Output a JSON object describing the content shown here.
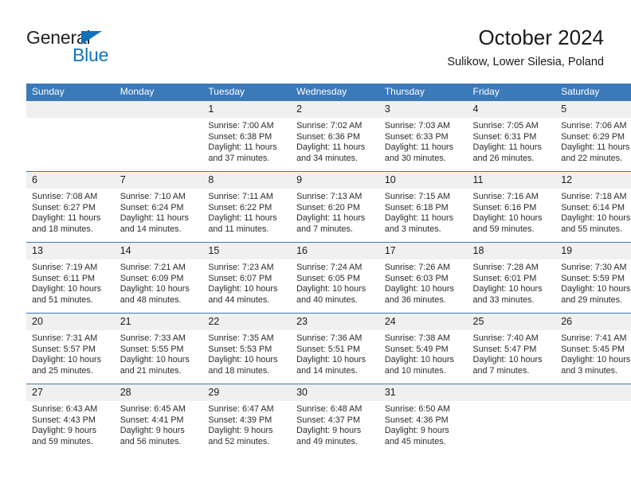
{
  "brand": {
    "name_part1": "General",
    "name_part2": "Blue",
    "logo_icon": "triangle-icon",
    "color_primary": "#1072bb",
    "color_text": "#231f20"
  },
  "header": {
    "title": "October 2024",
    "subtitle": "Sulikow, Lower Silesia, Poland"
  },
  "calendar": {
    "header_color": "#3b79b8",
    "daynum_bg": "#f0f0f0",
    "weekday_headers": [
      "Sunday",
      "Monday",
      "Tuesday",
      "Wednesday",
      "Thursday",
      "Friday",
      "Saturday"
    ],
    "weeks": [
      [
        {
          "day": "",
          "lines": []
        },
        {
          "day": "",
          "lines": []
        },
        {
          "day": "1",
          "lines": [
            "Sunrise: 7:00 AM",
            "Sunset: 6:38 PM",
            "Daylight: 11 hours",
            "and 37 minutes."
          ]
        },
        {
          "day": "2",
          "lines": [
            "Sunrise: 7:02 AM",
            "Sunset: 6:36 PM",
            "Daylight: 11 hours",
            "and 34 minutes."
          ]
        },
        {
          "day": "3",
          "lines": [
            "Sunrise: 7:03 AM",
            "Sunset: 6:33 PM",
            "Daylight: 11 hours",
            "and 30 minutes."
          ]
        },
        {
          "day": "4",
          "lines": [
            "Sunrise: 7:05 AM",
            "Sunset: 6:31 PM",
            "Daylight: 11 hours",
            "and 26 minutes."
          ]
        },
        {
          "day": "5",
          "lines": [
            "Sunrise: 7:06 AM",
            "Sunset: 6:29 PM",
            "Daylight: 11 hours",
            "and 22 minutes."
          ]
        }
      ],
      [
        {
          "day": "6",
          "lines": [
            "Sunrise: 7:08 AM",
            "Sunset: 6:27 PM",
            "Daylight: 11 hours",
            "and 18 minutes."
          ]
        },
        {
          "day": "7",
          "lines": [
            "Sunrise: 7:10 AM",
            "Sunset: 6:24 PM",
            "Daylight: 11 hours",
            "and 14 minutes."
          ]
        },
        {
          "day": "8",
          "lines": [
            "Sunrise: 7:11 AM",
            "Sunset: 6:22 PM",
            "Daylight: 11 hours",
            "and 11 minutes."
          ]
        },
        {
          "day": "9",
          "lines": [
            "Sunrise: 7:13 AM",
            "Sunset: 6:20 PM",
            "Daylight: 11 hours",
            "and 7 minutes."
          ]
        },
        {
          "day": "10",
          "lines": [
            "Sunrise: 7:15 AM",
            "Sunset: 6:18 PM",
            "Daylight: 11 hours",
            "and 3 minutes."
          ]
        },
        {
          "day": "11",
          "lines": [
            "Sunrise: 7:16 AM",
            "Sunset: 6:16 PM",
            "Daylight: 10 hours",
            "and 59 minutes."
          ]
        },
        {
          "day": "12",
          "lines": [
            "Sunrise: 7:18 AM",
            "Sunset: 6:14 PM",
            "Daylight: 10 hours",
            "and 55 minutes."
          ]
        }
      ],
      [
        {
          "day": "13",
          "lines": [
            "Sunrise: 7:19 AM",
            "Sunset: 6:11 PM",
            "Daylight: 10 hours",
            "and 51 minutes."
          ]
        },
        {
          "day": "14",
          "lines": [
            "Sunrise: 7:21 AM",
            "Sunset: 6:09 PM",
            "Daylight: 10 hours",
            "and 48 minutes."
          ]
        },
        {
          "day": "15",
          "lines": [
            "Sunrise: 7:23 AM",
            "Sunset: 6:07 PM",
            "Daylight: 10 hours",
            "and 44 minutes."
          ]
        },
        {
          "day": "16",
          "lines": [
            "Sunrise: 7:24 AM",
            "Sunset: 6:05 PM",
            "Daylight: 10 hours",
            "and 40 minutes."
          ]
        },
        {
          "day": "17",
          "lines": [
            "Sunrise: 7:26 AM",
            "Sunset: 6:03 PM",
            "Daylight: 10 hours",
            "and 36 minutes."
          ]
        },
        {
          "day": "18",
          "lines": [
            "Sunrise: 7:28 AM",
            "Sunset: 6:01 PM",
            "Daylight: 10 hours",
            "and 33 minutes."
          ]
        },
        {
          "day": "19",
          "lines": [
            "Sunrise: 7:30 AM",
            "Sunset: 5:59 PM",
            "Daylight: 10 hours",
            "and 29 minutes."
          ]
        }
      ],
      [
        {
          "day": "20",
          "lines": [
            "Sunrise: 7:31 AM",
            "Sunset: 5:57 PM",
            "Daylight: 10 hours",
            "and 25 minutes."
          ]
        },
        {
          "day": "21",
          "lines": [
            "Sunrise: 7:33 AM",
            "Sunset: 5:55 PM",
            "Daylight: 10 hours",
            "and 21 minutes."
          ]
        },
        {
          "day": "22",
          "lines": [
            "Sunrise: 7:35 AM",
            "Sunset: 5:53 PM",
            "Daylight: 10 hours",
            "and 18 minutes."
          ]
        },
        {
          "day": "23",
          "lines": [
            "Sunrise: 7:36 AM",
            "Sunset: 5:51 PM",
            "Daylight: 10 hours",
            "and 14 minutes."
          ]
        },
        {
          "day": "24",
          "lines": [
            "Sunrise: 7:38 AM",
            "Sunset: 5:49 PM",
            "Daylight: 10 hours",
            "and 10 minutes."
          ]
        },
        {
          "day": "25",
          "lines": [
            "Sunrise: 7:40 AM",
            "Sunset: 5:47 PM",
            "Daylight: 10 hours",
            "and 7 minutes."
          ]
        },
        {
          "day": "26",
          "lines": [
            "Sunrise: 7:41 AM",
            "Sunset: 5:45 PM",
            "Daylight: 10 hours",
            "and 3 minutes."
          ]
        }
      ],
      [
        {
          "day": "27",
          "lines": [
            "Sunrise: 6:43 AM",
            "Sunset: 4:43 PM",
            "Daylight: 9 hours",
            "and 59 minutes."
          ]
        },
        {
          "day": "28",
          "lines": [
            "Sunrise: 6:45 AM",
            "Sunset: 4:41 PM",
            "Daylight: 9 hours",
            "and 56 minutes."
          ]
        },
        {
          "day": "29",
          "lines": [
            "Sunrise: 6:47 AM",
            "Sunset: 4:39 PM",
            "Daylight: 9 hours",
            "and 52 minutes."
          ]
        },
        {
          "day": "30",
          "lines": [
            "Sunrise: 6:48 AM",
            "Sunset: 4:37 PM",
            "Daylight: 9 hours",
            "and 49 minutes."
          ]
        },
        {
          "day": "31",
          "lines": [
            "Sunrise: 6:50 AM",
            "Sunset: 4:36 PM",
            "Daylight: 9 hours",
            "and 45 minutes."
          ]
        },
        {
          "day": "",
          "lines": []
        },
        {
          "day": "",
          "lines": []
        }
      ]
    ]
  }
}
